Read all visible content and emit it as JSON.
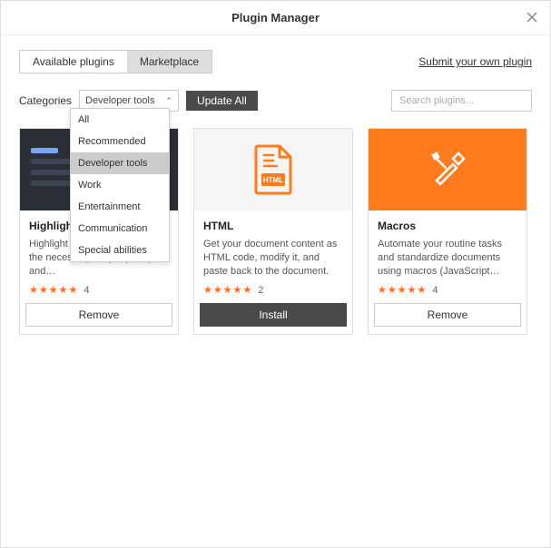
{
  "window": {
    "title": "Plugin Manager"
  },
  "tabs": {
    "available": "Available plugins",
    "marketplace": "Marketplace"
  },
  "submit_link": "Submit your own plugin",
  "categories": {
    "label": "Categories",
    "selected": "Developer tools",
    "options": [
      "All",
      "Recommended",
      "Developer tools",
      "Work",
      "Entertainment",
      "Communication",
      "Special abilities"
    ]
  },
  "update_all": "Update All",
  "search": {
    "placeholder": "Search plugins..."
  },
  "cards": [
    {
      "title": "Highlight",
      "desc": "Highlight code syntax selecting the necessary language, style, and…",
      "rating_count": "4",
      "action": "Remove",
      "action_style": "remove"
    },
    {
      "title": "HTML",
      "desc": "Get your document content as HTML code, modify it, and paste back to the document.",
      "rating_count": "2",
      "action": "Install",
      "action_style": "install"
    },
    {
      "title": "Macros",
      "desc": "Automate your routine tasks and standardize documents using macros (JavaScript…",
      "rating_count": "4",
      "action": "Remove",
      "action_style": "remove"
    }
  ]
}
